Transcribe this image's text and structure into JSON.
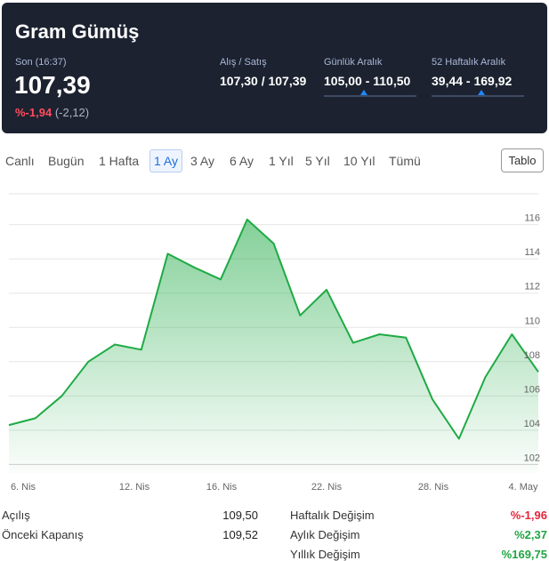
{
  "header": {
    "title": "Gram Gümüş",
    "last_label": "Son (16:37)",
    "price": "107,39",
    "change_pct": "%-1,94",
    "change_abs": "(-2,12)",
    "stats": [
      {
        "label": "Alış / Satış",
        "value": "107,30 / 107,39"
      },
      {
        "label": "Günlük Aralık",
        "value": "105,00 - 110,50",
        "position": 0.43
      },
      {
        "label": "52 Haftalık Aralık",
        "value": "39,44 - 169,92",
        "position": 0.54
      }
    ]
  },
  "tabs": [
    "Canlı",
    "Bugün",
    "1 Hafta",
    "1 Ay",
    "3 Ay",
    "6 Ay",
    "1 Yıl",
    "5 Yıl",
    "10 Yıl",
    "Tümü"
  ],
  "active_tab": "1 Ay",
  "tablo_label": "Tablo",
  "colors": {
    "header_bg": "#1c2230",
    "line": "#1faa45",
    "negative": "#e8243c",
    "positive": "#1fa642",
    "accent": "#1e6fd9"
  },
  "chart_data": {
    "type": "area",
    "x_ticks": [
      "6. Nis",
      "12. Nis",
      "16. Nis",
      "22. Nis",
      "28. Nis",
      "4. May"
    ],
    "y_ticks": [
      102,
      104,
      106,
      108,
      110,
      112,
      114,
      116
    ],
    "ylim": [
      101.5,
      117.8
    ],
    "x": [
      "5 Nis",
      "6 Nis",
      "7 Nis",
      "8 Nis",
      "10 Nis",
      "11 Nis",
      "12 Nis",
      "13 Nis",
      "14 Nis",
      "16 Nis",
      "17 Nis",
      "18 Nis",
      "19 Nis",
      "20 Nis",
      "21 Nis",
      "22 Nis",
      "24 Nis",
      "25 Nis",
      "27 Nis",
      "28 Nis",
      "29 Nis",
      "1 May",
      "3 May",
      "4 May"
    ],
    "values": [
      104.3,
      104.7,
      106.0,
      108.0,
      109.0,
      108.7,
      114.3,
      113.5,
      112.8,
      116.3,
      114.9,
      110.7,
      112.2,
      109.1,
      109.6,
      109.4,
      105.8,
      103.5,
      107.1,
      109.6,
      107.4
    ],
    "grid": true,
    "legend": "none"
  },
  "summary": {
    "left": [
      {
        "label": "Açılış",
        "value": "109,50"
      },
      {
        "label": "Önceki Kapanış",
        "value": "109,52"
      }
    ],
    "right": [
      {
        "label": "Haftalık Değişim",
        "value": "%-1,96",
        "sign": "neg"
      },
      {
        "label": "Aylık Değişim",
        "value": "%2,37",
        "sign": "pos"
      },
      {
        "label": "Yıllık Değişim",
        "value": "%169,75",
        "sign": "pos"
      }
    ]
  }
}
